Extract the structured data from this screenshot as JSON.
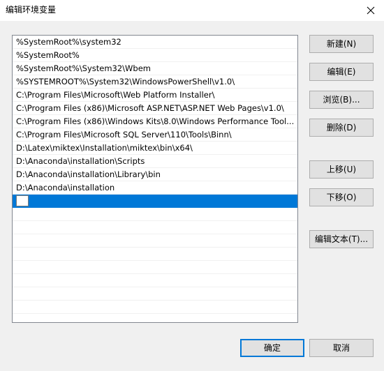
{
  "window": {
    "title": "编辑环境变量",
    "close_glyph": "close-icon"
  },
  "list": {
    "items": [
      "%SystemRoot%\\system32",
      "%SystemRoot%",
      "%SystemRoot%\\System32\\Wbem",
      "%SYSTEMROOT%\\System32\\WindowsPowerShell\\v1.0\\",
      "C:\\Program Files\\Microsoft\\Web Platform Installer\\",
      "C:\\Program Files (x86)\\Microsoft ASP.NET\\ASP.NET Web Pages\\v1.0\\",
      "C:\\Program Files (x86)\\Windows Kits\\8.0\\Windows Performance Tool...",
      "C:\\Program Files\\Microsoft SQL Server\\110\\Tools\\Binn\\",
      "D:\\Latex\\miktex\\Installation\\miktex\\bin\\x64\\",
      "D:\\Anaconda\\installation\\Scripts",
      "D:\\Anaconda\\installation\\Library\\bin",
      "D:\\Anaconda\\installation"
    ],
    "editing_value": ""
  },
  "buttons": {
    "new": "新建(N)",
    "edit": "编辑(E)",
    "browse": "浏览(B)...",
    "delete": "删除(D)",
    "move_up": "上移(U)",
    "move_down": "下移(O)",
    "edit_text": "编辑文本(T)...",
    "ok": "确定",
    "cancel": "取消"
  },
  "colors": {
    "selection": "#0078d7",
    "dialog_bg": "#f0f0f0",
    "button_bg": "#e1e1e1"
  }
}
